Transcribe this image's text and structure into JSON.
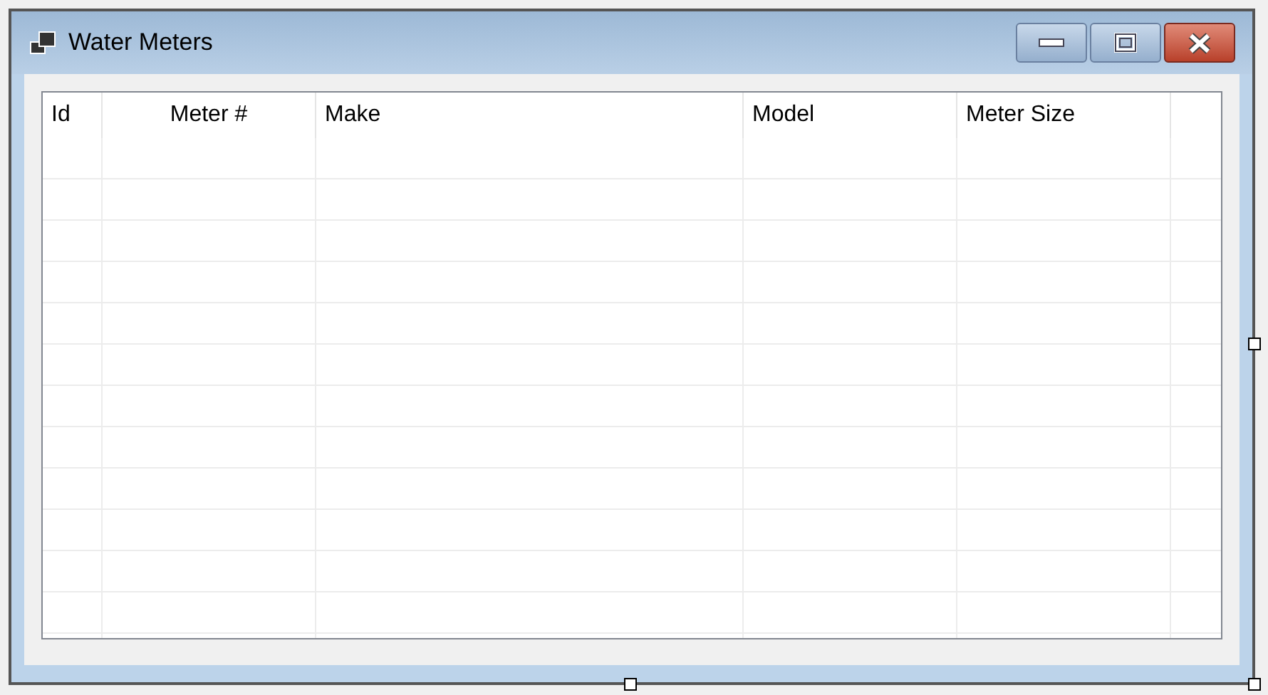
{
  "window": {
    "title": "Water Meters"
  },
  "list_view": {
    "columns": [
      {
        "label": "Id",
        "centered": false
      },
      {
        "label": "Meter #",
        "centered": true
      },
      {
        "label": "Make",
        "centered": false
      },
      {
        "label": "Model",
        "centered": false
      },
      {
        "label": "Meter Size",
        "centered": false
      }
    ]
  }
}
